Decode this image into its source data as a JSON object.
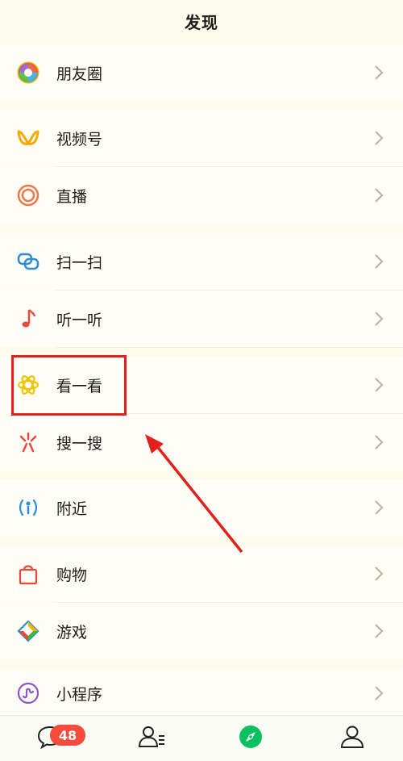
{
  "header": {
    "title": "发现"
  },
  "items": [
    {
      "key": "moments",
      "label": "朋友圈",
      "icon": "moments-icon"
    },
    {
      "key": "channels",
      "label": "视频号",
      "icon": "channels-icon"
    },
    {
      "key": "live",
      "label": "直播",
      "icon": "live-icon"
    },
    {
      "key": "scan",
      "label": "扫一扫",
      "icon": "scan-icon"
    },
    {
      "key": "listen",
      "label": "听一听",
      "icon": "music-note-icon"
    },
    {
      "key": "top-stories",
      "label": "看一看",
      "icon": "top-stories-icon"
    },
    {
      "key": "search",
      "label": "搜一搜",
      "icon": "search-sparkle-icon"
    },
    {
      "key": "nearby",
      "label": "附近",
      "icon": "nearby-icon"
    },
    {
      "key": "shopping",
      "label": "购物",
      "icon": "shopping-bag-icon"
    },
    {
      "key": "games",
      "label": "游戏",
      "icon": "games-icon"
    },
    {
      "key": "mini-programs",
      "label": "小程序",
      "icon": "mini-programs-icon"
    }
  ],
  "tabbar": {
    "chats_badge": "48",
    "tabs": [
      {
        "key": "chats",
        "icon": "chat-bubble-icon"
      },
      {
        "key": "contacts",
        "icon": "contacts-icon"
      },
      {
        "key": "discover",
        "icon": "compass-icon",
        "active": true
      },
      {
        "key": "me",
        "icon": "person-icon"
      }
    ]
  },
  "colors": {
    "background": "#fdfbec",
    "accent_green": "#07c160",
    "badge": "#f54b3a",
    "highlight": "#e0211d"
  }
}
